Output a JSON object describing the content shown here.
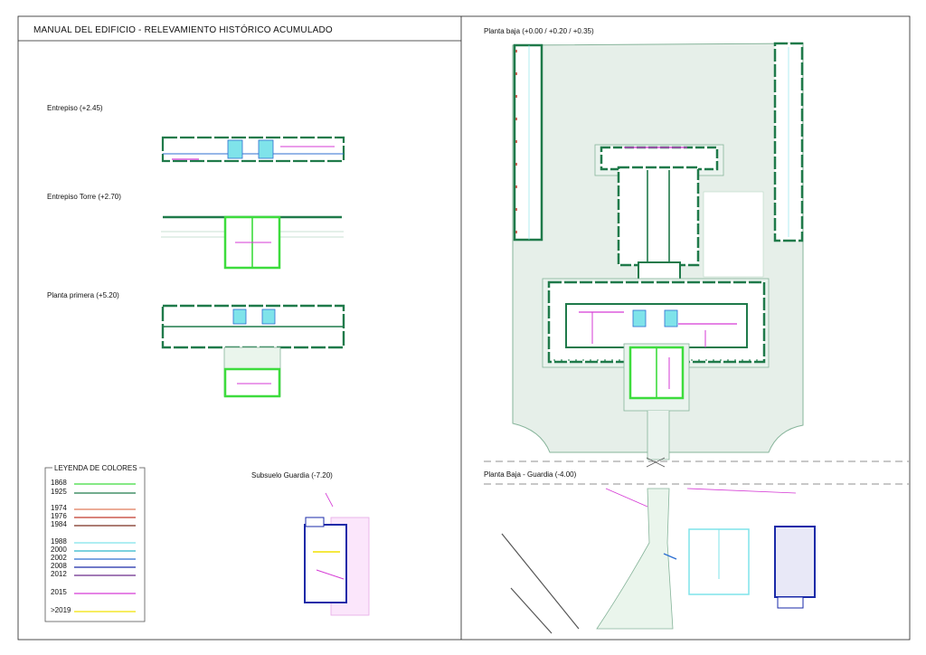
{
  "sheet": {
    "title": "MANUAL DEL EDIFICIO - RELEVAMIENTO HISTÓRICO ACUMULADO"
  },
  "plans": {
    "entrepiso": "Entrepiso (+2.45)",
    "entrepiso_torre": "Entrepiso Torre (+2.70)",
    "planta_primera": "Planta primera (+5.20)",
    "subsuelo_guardia": "Subsuelo Guardia (-7.20)",
    "planta_baja": "Planta baja (+0.00 / +0.20 / +0.35)",
    "planta_baja_guardia": "Planta Baja - Guardia (-4.00)"
  },
  "legend": {
    "title": "LEYENDA DE COLORES",
    "items": [
      {
        "year": "1868",
        "color": "#3ddc3d"
      },
      {
        "year": "1925",
        "color": "#1f7a4a"
      },
      {
        "year": "1974",
        "color": "#e07a5a"
      },
      {
        "year": "1976",
        "color": "#c0392b"
      },
      {
        "year": "1984",
        "color": "#7a2e1e"
      },
      {
        "year": "1988",
        "color": "#7fe3ea"
      },
      {
        "year": "2000",
        "color": "#2fb7c9"
      },
      {
        "year": "2002",
        "color": "#2d6fd1"
      },
      {
        "year": "2008",
        "color": "#1a2aa8"
      },
      {
        "year": "2012",
        "color": "#6a2a8a"
      },
      {
        "year": "2015",
        "color": "#d53ad5"
      },
      {
        "year": ">2019",
        "color": "#f2e200"
      }
    ]
  },
  "colors": {
    "frame": "#222222",
    "site_fill": "#e6efe9",
    "site_stroke": "#86b49a",
    "wall_1925": "#1f7a4a",
    "wall_1868": "#3ddc3d",
    "cyan": "#7fe3ea",
    "magenta": "#d53ad5",
    "blue": "#1a2aa8"
  }
}
